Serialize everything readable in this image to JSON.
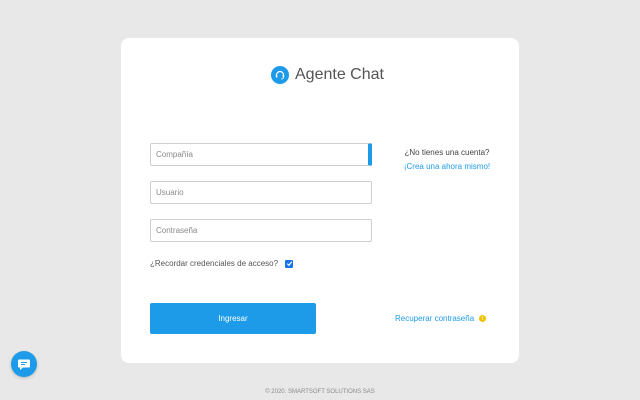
{
  "brand": {
    "title": "Agente Chat",
    "icon": "headset-icon",
    "color": "#1e9be8"
  },
  "form": {
    "company_placeholder": "Compañía",
    "user_placeholder": "Usuario",
    "password_placeholder": "Contraseña",
    "remember_label": "¿Recordar credenciales de acceso?",
    "remember_checked": true,
    "submit_label": "Ingresar"
  },
  "signup": {
    "question": "¿No tienes una cuenta?",
    "link": "¡Crea una ahora mismo!"
  },
  "recover": {
    "link": "Recuperar contraseña",
    "icon": "info-icon"
  },
  "footer": {
    "text": "© 2020. SMARTSOFT SOLUTIONS SAS"
  },
  "chat_widget": {
    "icon": "chat-bubble-icon"
  }
}
